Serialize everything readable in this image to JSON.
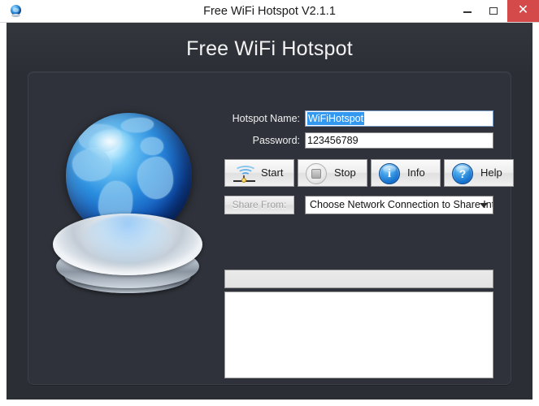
{
  "window": {
    "title": "Free WiFi Hotspot V2.1.1",
    "app_icon": "globe-icon",
    "controls": {
      "minimize": "minimize-icon",
      "maximize": "maximize-icon",
      "close": "✕"
    }
  },
  "main": {
    "heading": "Free WiFi Hotspot",
    "graphic": "globe-on-pedestal-illustration",
    "form": {
      "hotspot_name_label": "Hotspot Name:",
      "hotspot_name_value": "WiFiHotspot",
      "hotspot_name_selected": true,
      "password_label": "Password:",
      "password_value": "123456789"
    },
    "buttons": [
      {
        "label": "Start",
        "icon": "wifi-signal-icon",
        "enabled": true
      },
      {
        "label": "Stop",
        "icon": "stop-square-icon",
        "enabled": false
      },
      {
        "label": "Info",
        "icon": "info-circle-icon",
        "enabled": true
      },
      {
        "label": "Help",
        "icon": "help-question-icon",
        "enabled": true
      }
    ],
    "share": {
      "button_label": "Share From:",
      "button_enabled": false,
      "dropdown_value": "Choose Network Connection to Share Internet",
      "dropdown_icon": "chevron-down-icon"
    },
    "client_list": {
      "header_text": "",
      "rows": []
    }
  },
  "colors": {
    "window_background": "#ffffff",
    "body_background": "#2b2e35",
    "panel_background": "#2f323a",
    "close_button": "#d44a4a",
    "accent_blue": "#3399f0",
    "selection_highlight": "#3399f0",
    "label_text": "#f0f0f0"
  }
}
